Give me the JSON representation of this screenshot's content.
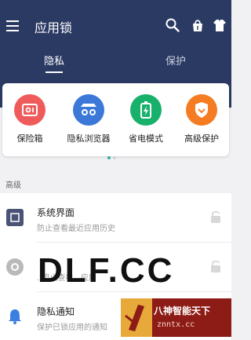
{
  "header": {
    "title": "应用锁",
    "icons": [
      "search-icon",
      "broom-icon",
      "shirt-icon"
    ]
  },
  "tabs": [
    {
      "label": "隐私",
      "active": true
    },
    {
      "label": "保护",
      "active": false
    }
  ],
  "features": [
    {
      "label": "保险箱",
      "icon": "safe-icon",
      "color": "#ef5b5b"
    },
    {
      "label": "隐私浏览器",
      "icon": "incognito-icon",
      "color": "#3c78d8"
    },
    {
      "label": "省电模式",
      "icon": "battery-icon",
      "color": "#18b16b"
    },
    {
      "label": "高级保护",
      "icon": "shield-icon",
      "color": "#f57c22"
    }
  ],
  "pager": {
    "pages": 2,
    "current": 1
  },
  "section": {
    "title": "高级"
  },
  "rows": [
    {
      "title": "系统界面",
      "subtitle": "防止查看最近应用历史",
      "icon": "recent-apps-icon"
    },
    {
      "title": "",
      "subtitle": "..阻止查看...应用",
      "icon": "gear-icon"
    },
    {
      "title": "隐私通知",
      "subtitle": "保护已锁应用的通知",
      "icon": "bell-icon"
    }
  ],
  "watermark": {
    "text": "DLF.CC",
    "brand": "八神智能天下",
    "url": "znntx.cc"
  },
  "colors": {
    "header_bg": "#2b3a63",
    "accent_dot": "#2bb6a0"
  }
}
